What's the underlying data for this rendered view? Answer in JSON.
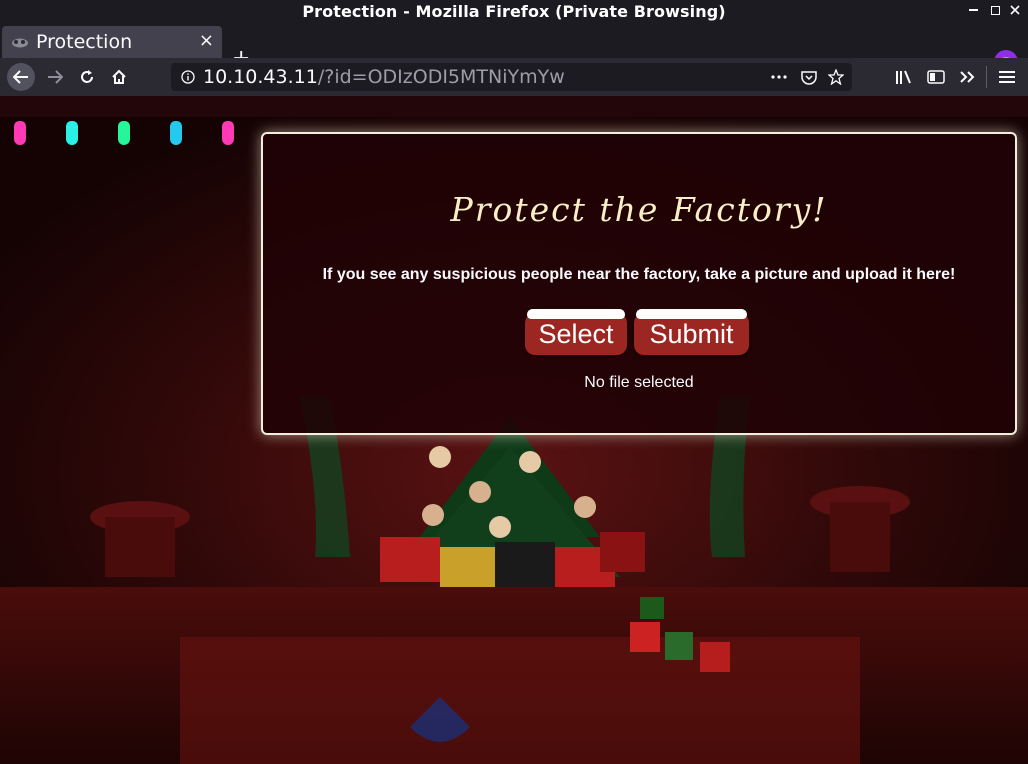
{
  "window": {
    "title": "Protection - Mozilla Firefox (Private Browsing)"
  },
  "tabs": [
    {
      "label": "Protection",
      "close": "×"
    }
  ],
  "newtab_label": "+",
  "navbar": {
    "url_host": "10.10.43.11",
    "url_path": "/?id=ODIzODI5MTNiYmYw"
  },
  "page": {
    "heading": "Protect the Factory!",
    "message": "If you see any suspicious people near the factory, take a picture and upload it here!",
    "select_button": "Select",
    "submit_button": "Submit",
    "file_status": "No file selected"
  },
  "colors": {
    "accent_button": "#9c2622",
    "card_border": "#f4eede",
    "private_badge": "#8e2ee6"
  }
}
